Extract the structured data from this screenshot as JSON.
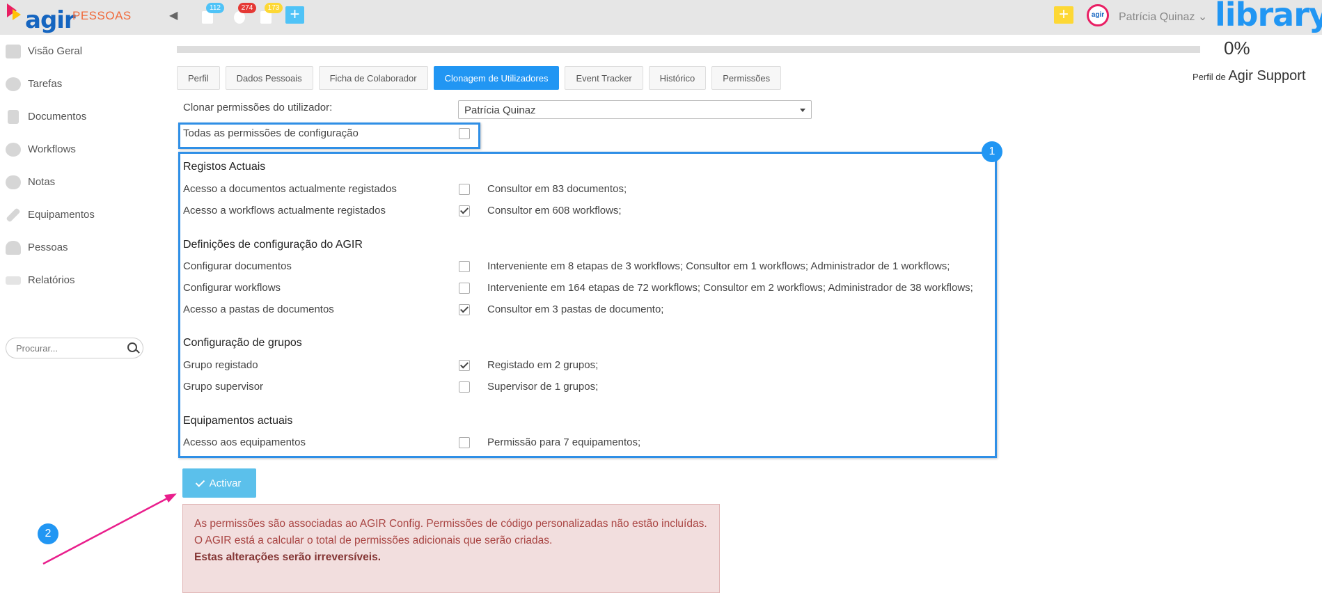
{
  "topbar": {
    "module": "PESSOAS",
    "badges": [
      "112",
      "274",
      "173"
    ],
    "username": "Patrícia Quinaz",
    "brand": "library",
    "avatar_text": "agir"
  },
  "sidebar": {
    "items": [
      {
        "label": "Visão Geral",
        "icon": "home-icon"
      },
      {
        "label": "Tarefas",
        "icon": "gear-icon"
      },
      {
        "label": "Documentos",
        "icon": "document-icon"
      },
      {
        "label": "Workflows",
        "icon": "workflow-icon"
      },
      {
        "label": "Notas",
        "icon": "notes-icon"
      },
      {
        "label": "Equipamentos",
        "icon": "wrench-icon"
      },
      {
        "label": "Pessoas",
        "icon": "person-icon"
      },
      {
        "label": "Relatórios",
        "icon": "chart-icon"
      }
    ],
    "search_placeholder": "Procurar..."
  },
  "progress": {
    "value": 0,
    "label": "0%"
  },
  "profile": {
    "prefix": "Perfil de",
    "name": "Agir Support"
  },
  "tabs": [
    {
      "label": "Perfil"
    },
    {
      "label": "Dados Pessoais"
    },
    {
      "label": "Ficha de Colaborador"
    },
    {
      "label": "Clonagem de Utilizadores",
      "active": true
    },
    {
      "label": "Event Tracker"
    },
    {
      "label": "Histórico"
    },
    {
      "label": "Permissões"
    }
  ],
  "clone": {
    "label": "Clonar permissões do utilizador:",
    "selected": "Patrícia Quinaz",
    "all_config_label": "Todas as permissões de configuração"
  },
  "sections": [
    {
      "title": "Registos Actuais",
      "rows": [
        {
          "label": "Acesso a documentos actualmente registados",
          "checked": false,
          "desc": "Consultor em 83 documentos;"
        },
        {
          "label": "Acesso a workflows actualmente registados",
          "checked": true,
          "desc": "Consultor em 608 workflows;"
        }
      ]
    },
    {
      "title": "Definições de configuração do AGIR",
      "rows": [
        {
          "label": "Configurar documentos",
          "checked": false,
          "desc": "Interveniente em 8 etapas de 3 workflows; Consultor em 1 workflows; Administrador de 1 workflows;"
        },
        {
          "label": "Configurar workflows",
          "checked": false,
          "desc": "Interveniente em 164 etapas de 72 workflows; Consultor em 2 workflows; Administrador de 38 workflows;"
        },
        {
          "label": "Acesso a pastas de documentos",
          "checked": true,
          "desc": "Consultor em 3 pastas de documento;"
        }
      ]
    },
    {
      "title": "Configuração de grupos",
      "rows": [
        {
          "label": "Grupo registado",
          "checked": true,
          "desc": "Registado em 2 grupos;"
        },
        {
          "label": "Grupo supervisor",
          "checked": false,
          "desc": "Supervisor de 1 grupos;"
        }
      ]
    },
    {
      "title": "Equipamentos actuais",
      "rows": [
        {
          "label": "Acesso aos equipamentos",
          "checked": false,
          "desc": "Permissão para 7 equipamentos;"
        }
      ]
    }
  ],
  "markers": [
    "1",
    "2"
  ],
  "activate_label": "Activar",
  "alert": {
    "line1": "As permissões são associadas ao AGIR Config. Permissões de código personalizadas não estão incluídas.",
    "line2": "O AGIR está a calcular o total de permissões adicionais que serão criadas.",
    "line3": "Estas alterações serão irreversíveis."
  },
  "colors": {
    "accent": "#2196f3",
    "module": "#f06a3b",
    "alert_bg": "#f2dede",
    "alert_text": "#a94442",
    "annotation_arrow": "#e91e8c"
  }
}
